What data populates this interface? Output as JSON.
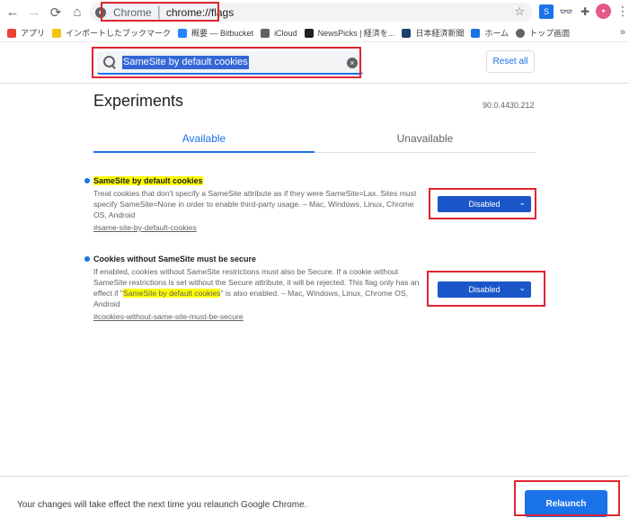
{
  "browser": {
    "site_label": "Chrome",
    "url": "chrome://flags"
  },
  "bookmarks": [
    {
      "label": "アプリ",
      "icon": "apps-grid-icon",
      "color": "#ea4335"
    },
    {
      "label": "インポートしたブックマーク",
      "icon": "folder-icon",
      "color": "#f4c20d"
    },
    {
      "label": "概要 — Bitbucket",
      "icon": "bitbucket-icon",
      "color": "#2684ff"
    },
    {
      "label": "iCloud",
      "icon": "apple-icon",
      "color": "#5f6368"
    },
    {
      "label": "NewsPicks | 経済を...",
      "icon": "newspicks-icon",
      "color": "#202124"
    },
    {
      "label": "日本経済新聞",
      "icon": "nikkei-icon",
      "color": "#1c3f6e"
    },
    {
      "label": "ホーム",
      "icon": "home-icon",
      "color": "#1a73e8"
    },
    {
      "label": "トップ画面",
      "icon": "globe-icon",
      "color": "#5f6368"
    }
  ],
  "flags": {
    "search_value": "SameSite by default cookies",
    "reset_label": "Reset all",
    "title": "Experiments",
    "version": "90.0.4430.212",
    "tabs": [
      {
        "label": "Available"
      },
      {
        "label": "Unavailable"
      }
    ],
    "experiments": [
      {
        "title": "SameSite by default cookies",
        "desc": "Treat cookies that don't specify a SameSite attribute as if they were SameSite=Lax. Sites must specify SameSite=None in order to enable third-party usage. – Mac, Windows, Linux, Chrome OS, Android",
        "link": "#same-site-by-default-cookies",
        "value": "Disabled"
      },
      {
        "title": "Cookies without SameSite must be secure",
        "desc_before": "If enabled, cookies without SameSite restrictions must also be Secure. If a cookie without SameSite restrictions is set without the Secure attribute, it will be rejected. This flag only has an effect if \"",
        "desc_highlight": "SameSite by default cookies",
        "desc_after": "\" is also enabled. – Mac, Windows, Linux, Chrome OS, Android",
        "link": "#cookies-without-same-site-must-be-secure",
        "value": "Disabled"
      }
    ]
  },
  "footer": {
    "message": "Your changes will take effect the next time you relaunch Google Chrome.",
    "relaunch_label": "Relaunch"
  }
}
